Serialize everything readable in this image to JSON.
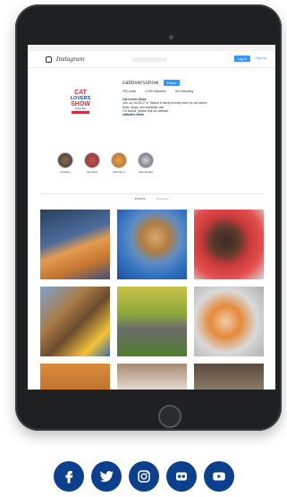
{
  "instagram": {
    "app_name": "Instagram",
    "login_label": "Log In",
    "signup_label": "Sign Up",
    "username": "catloversshow",
    "follow_label": "Follow",
    "stats": {
      "posts": "252 posts",
      "followers": "2,049 followers",
      "following": "310 following"
    },
    "bio": {
      "name": "Cat Lovers Show",
      "line1": "Join us Oct 26-27 in Tampa! A family-friendly event for cat lovers!",
      "line2": "Meet, adopt, and celebrate cats",
      "line3": "For tickets, please visit our website",
      "link": "catlovers show"
    },
    "highlights": [
      {
        "label": "Cat Expo"
      },
      {
        "label": "Cat Show"
      },
      {
        "label": "Cats Day 2"
      },
      {
        "label": "Cats Sunday"
      }
    ],
    "tabs": {
      "posts": "POSTS",
      "tagged": "TAGGED"
    }
  },
  "logo": {
    "line1": "CAT",
    "line2": "LOVERS",
    "line3": "SHOW",
    "tagline": "Tampa Bay"
  },
  "social": [
    {
      "name": "facebook-icon"
    },
    {
      "name": "twitter-icon"
    },
    {
      "name": "instagram-icon"
    },
    {
      "name": "flickr-icon"
    },
    {
      "name": "youtube-icon"
    }
  ],
  "colors": {
    "social_blue": "#0c3f8c",
    "ig_blue": "#3897f0",
    "tablet_body": "#1f2021"
  }
}
